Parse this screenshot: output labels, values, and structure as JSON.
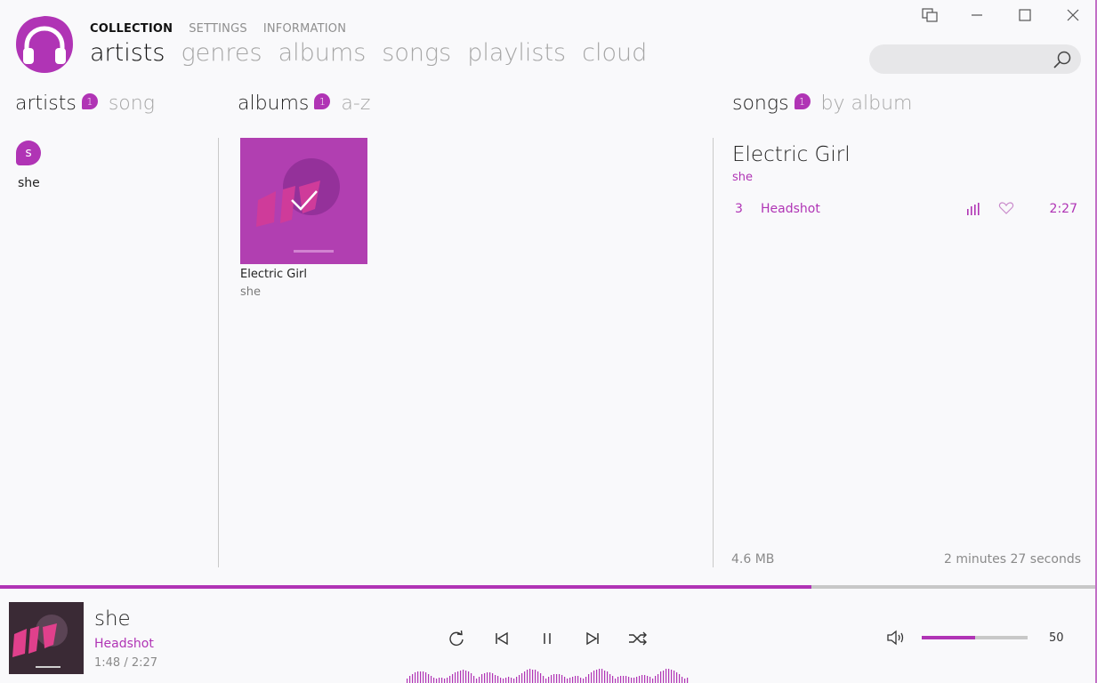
{
  "window": {
    "buttons": [
      "compact-overlay",
      "minimize",
      "maximize",
      "close"
    ]
  },
  "brand": {
    "accent": "#b034b5",
    "logo_icon": "headphones-icon"
  },
  "top_tabs": [
    {
      "label": "COLLECTION",
      "active": true
    },
    {
      "label": "SETTINGS",
      "active": false
    },
    {
      "label": "INFORMATION",
      "active": false
    }
  ],
  "sub_tabs": [
    {
      "label": "artists",
      "active": true
    },
    {
      "label": "genres",
      "active": false
    },
    {
      "label": "albums",
      "active": false
    },
    {
      "label": "songs",
      "active": false
    },
    {
      "label": "playlists",
      "active": false
    },
    {
      "label": "cloud",
      "active": false
    }
  ],
  "search": {
    "placeholder": "",
    "icon": "search-icon"
  },
  "artists_col": {
    "title": "artists",
    "count": "1",
    "sort": "song",
    "group_letter": "s",
    "items": [
      "she"
    ]
  },
  "albums_col": {
    "title": "albums",
    "count": "1",
    "sort": "a-z",
    "items": [
      {
        "title": "Electric Girl",
        "artist": "she",
        "selected": true
      }
    ]
  },
  "songs_col": {
    "title": "songs",
    "count": "1",
    "sort": "by album",
    "album": "Electric Girl",
    "artist": "she",
    "tracks": [
      {
        "number": "3",
        "title": "Headshot",
        "duration": "2:27"
      }
    ],
    "total_size": "4.6 MB",
    "total_duration": "2 minutes 27 seconds"
  },
  "now_playing": {
    "artist": "she",
    "title": "Headshot",
    "time": "1:48 / 2:27",
    "progress_fraction": 0.74
  },
  "volume": {
    "value": "50",
    "fraction": 0.5
  }
}
